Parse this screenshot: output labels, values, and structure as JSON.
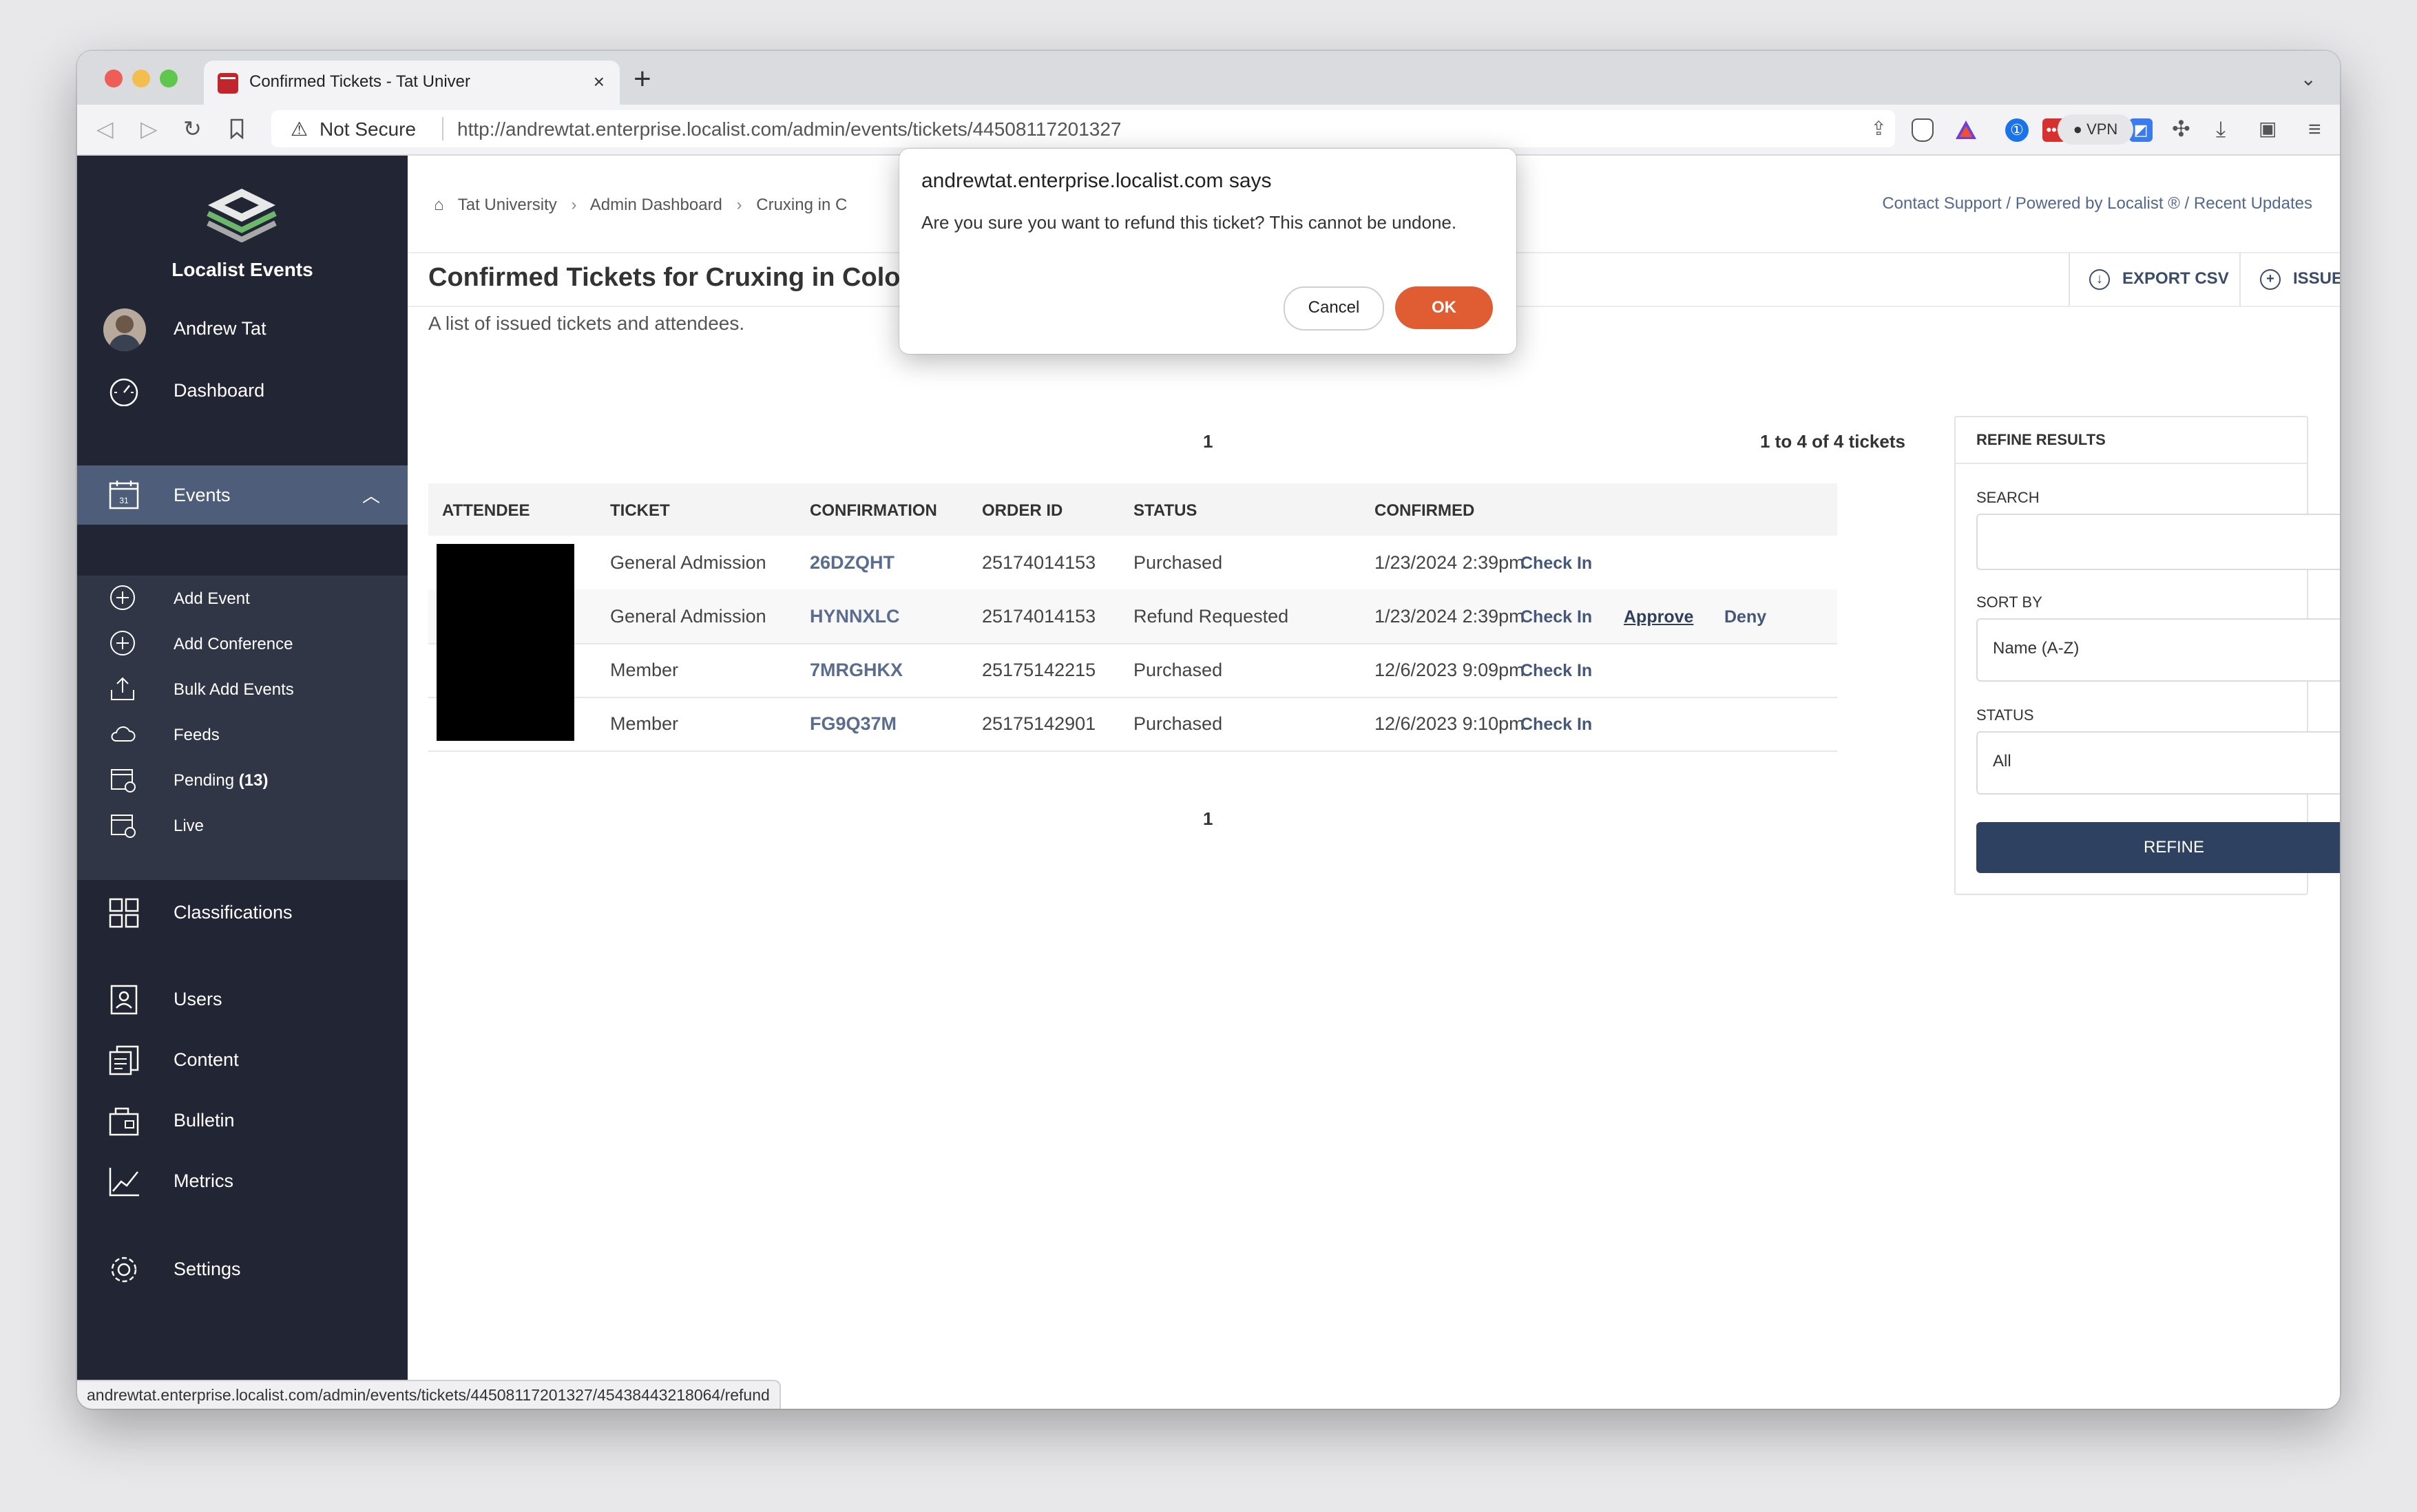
{
  "browser": {
    "tab_title": "Confirmed Tickets - Tat Univer",
    "tab_close": "×",
    "new_tab": "+",
    "tab_list": "⌄",
    "security_label": "Not Secure",
    "url": "http://andrewtat.enterprise.localist.com/admin/events/tickets/44508117201327",
    "vpn_label": "VPN",
    "status_url": "andrewtat.enterprise.localist.com/admin/events/tickets/44508117201327/45438443218064/refund",
    "icons": [
      "back-icon",
      "forward-icon",
      "reload-icon",
      "bookmark-icon",
      "share-icon",
      "brave-shield-icon",
      "brave-rewards-icon",
      "onepassword-icon",
      "extension-red-icon",
      "medium-icon",
      "extension-blue-icon",
      "puzzle-icon",
      "download-icon",
      "sidebar-icon",
      "menu-icon"
    ]
  },
  "sidebar": {
    "brand": "Localist Events",
    "user": "Andrew Tat",
    "dashboard": "Dashboard",
    "events": "Events",
    "events_sub": {
      "add_event": "Add Event",
      "add_conference": "Add Conference",
      "bulk_add": "Bulk Add Events",
      "feeds": "Feeds",
      "pending_label": "Pending",
      "pending_count": "(13)",
      "live": "Live"
    },
    "classifications": "Classifications",
    "users": "Users",
    "content": "Content",
    "bulletin": "Bulletin",
    "metrics": "Metrics",
    "settings": "Settings"
  },
  "breadcrumb": {
    "home": "Tat University",
    "sep": "›",
    "admin": "Admin Dashboard",
    "event": "Cruxing in C"
  },
  "top_links": "Contact Support / Powered by Localist ® / Recent Updates",
  "header": {
    "title": "Confirmed Tickets for Cruxing in Color",
    "subtitle": "A list of issued tickets and attendees.",
    "export_csv": "EXPORT CSV",
    "issue_ticket": "ISSUE TICKET"
  },
  "pagination": {
    "page": "1",
    "count": "1 to 4 of 4 tickets"
  },
  "table": {
    "columns": [
      "ATTENDEE",
      "TICKET",
      "CONFIRMATION",
      "ORDER ID",
      "STATUS",
      "CONFIRMED"
    ],
    "rows": [
      {
        "ticket": "General Admission",
        "confirmation": "26DZQHT",
        "order_id": "25174014153",
        "status": "Purchased",
        "confirmed": "1/23/2024 2:39pm",
        "check_in": "Check In"
      },
      {
        "ticket": "General Admission",
        "confirmation": "HYNNXLC",
        "order_id": "25174014153",
        "status": "Refund Requested",
        "confirmed": "1/23/2024 2:39pm",
        "check_in": "Check In",
        "approve": "Approve",
        "deny": "Deny"
      },
      {
        "ticket": "Member",
        "confirmation": "7MRGHKX",
        "order_id": "25175142215",
        "status": "Purchased",
        "confirmed": "12/6/2023 9:09pm",
        "check_in": "Check In"
      },
      {
        "ticket": "Member",
        "confirmation": "FG9Q37M",
        "order_id": "25175142901",
        "status": "Purchased",
        "confirmed": "12/6/2023 9:10pm",
        "check_in": "Check In"
      }
    ]
  },
  "refine": {
    "title": "REFINE RESULTS",
    "search_label": "SEARCH",
    "search_value": "",
    "sort_label": "SORT BY",
    "sort_value": "Name (A-Z)",
    "status_label": "STATUS",
    "status_value": "All",
    "button": "REFINE"
  },
  "dialog": {
    "title": "andrewtat.enterprise.localist.com says",
    "message": "Are you sure you want to refund this ticket? This cannot be undone.",
    "cancel": "Cancel",
    "ok": "OK"
  },
  "colors": {
    "sidebar_bg": "#222634",
    "events_active": "#4e5d7a",
    "primary_button": "#2e4160",
    "ok_button": "#e05d34",
    "link": "#52688f"
  }
}
